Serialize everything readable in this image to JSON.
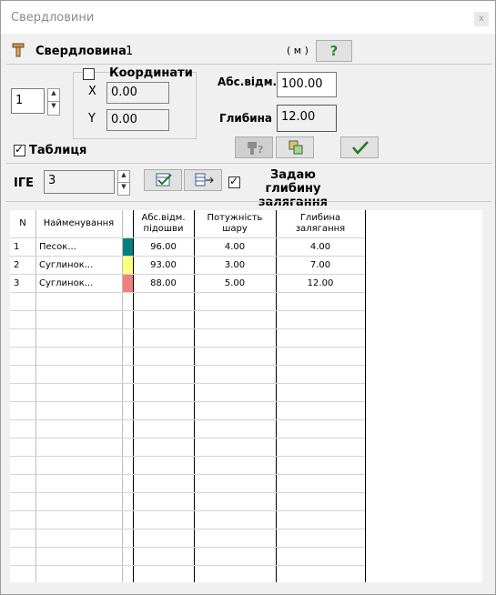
{
  "window": {
    "title": "Свердловини",
    "close_label": "x"
  },
  "header": {
    "label": "Свердловина",
    "number": "1",
    "units": "( м )",
    "help": "?"
  },
  "well_select": {
    "value": "1"
  },
  "coordinates": {
    "label": "Координати",
    "checked": false,
    "x_label": "X",
    "x_value": "0.00",
    "y_label": "Y",
    "y_value": "0.00"
  },
  "abs_elevation": {
    "label": "Абс.відм.",
    "value": "100.00"
  },
  "depth": {
    "label": "Глибина",
    "value": "12.00"
  },
  "table_toggle": {
    "label": "Таблиця",
    "checked": true
  },
  "ige": {
    "label": "ІГЕ",
    "value": "3"
  },
  "depth_toggle": {
    "label": "Задаю глибину залягання",
    "checked": true
  },
  "colors": {
    "teal": "#008080",
    "yellow": "#ffff80",
    "salmon": "#f08080"
  },
  "table": {
    "columns": [
      "N",
      "Найменування",
      "",
      "Абс.відм. підошви",
      "Потужність шару",
      "Глибина залягання"
    ],
    "rows": [
      {
        "n": "1",
        "name": "Песок...",
        "color": "#008080",
        "abs": "96.00",
        "thick": "4.00",
        "depth": "4.00"
      },
      {
        "n": "2",
        "name": "Суглинок...",
        "color": "#ffff80",
        "abs": "93.00",
        "thick": "3.00",
        "depth": "7.00"
      },
      {
        "n": "3",
        "name": "Суглинок...",
        "color": "#f08080",
        "abs": "88.00",
        "thick": "5.00",
        "depth": "12.00"
      }
    ]
  }
}
